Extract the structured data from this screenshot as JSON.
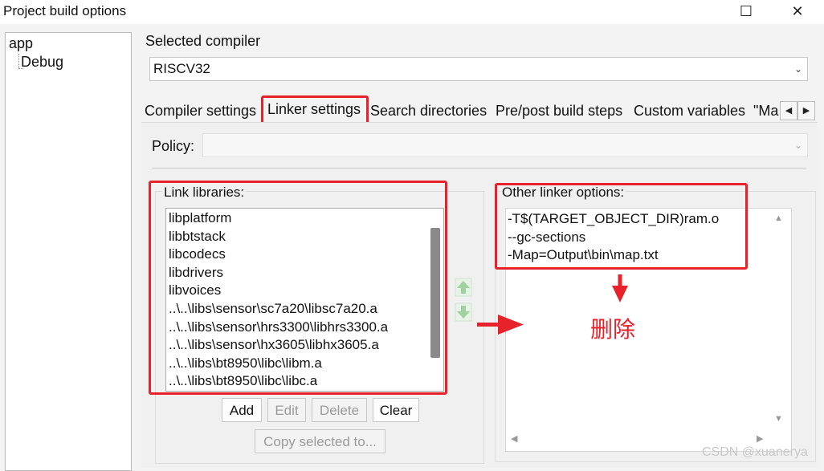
{
  "window": {
    "title": "Project build options",
    "maximize_glyph": "☐",
    "close_glyph": "✕"
  },
  "tree": {
    "root": "app",
    "child": "Debug"
  },
  "compiler": {
    "label": "Selected compiler",
    "value": "RISCV32"
  },
  "tabs": [
    {
      "label": "Compiler settings"
    },
    {
      "label": "Linker settings"
    },
    {
      "label": "Search directories"
    },
    {
      "label": "Pre/post build steps"
    },
    {
      "label": "Custom variables"
    },
    {
      "label": "\"Ma"
    }
  ],
  "tab_scroll": {
    "left": "◀",
    "right": "▶"
  },
  "policy": {
    "label": "Policy:",
    "value": ""
  },
  "link_libraries": {
    "label": "Link libraries:",
    "items": [
      "libplatform",
      "libbtstack",
      "libcodecs",
      "libdrivers",
      "libvoices",
      "..\\..\\libs\\sensor\\sc7a20\\libsc7a20.a",
      "..\\..\\libs\\sensor\\hrs3300\\libhrs3300.a",
      "..\\..\\libs\\sensor\\hx3605\\libhx3605.a",
      "..\\..\\libs\\bt8950\\libc\\libm.a",
      "..\\..\\libs\\bt8950\\libc\\libc.a"
    ],
    "buttons": {
      "add": "Add",
      "edit": "Edit",
      "delete": "Delete",
      "clear": "Clear",
      "copy": "Copy selected to..."
    }
  },
  "other_linker_options": {
    "label": "Other linker options:",
    "lines": [
      "-T$(TARGET_OBJECT_DIR)ram.o",
      "--gc-sections",
      "-Map=Output\\bin\\map.txt"
    ]
  },
  "annotation": {
    "text": "删除",
    "color": "#e8222b"
  },
  "watermark": "CSDN @xuanerya",
  "colors": {
    "highlight_red": "#e8222b",
    "arrow_green": "#5cb85c"
  }
}
